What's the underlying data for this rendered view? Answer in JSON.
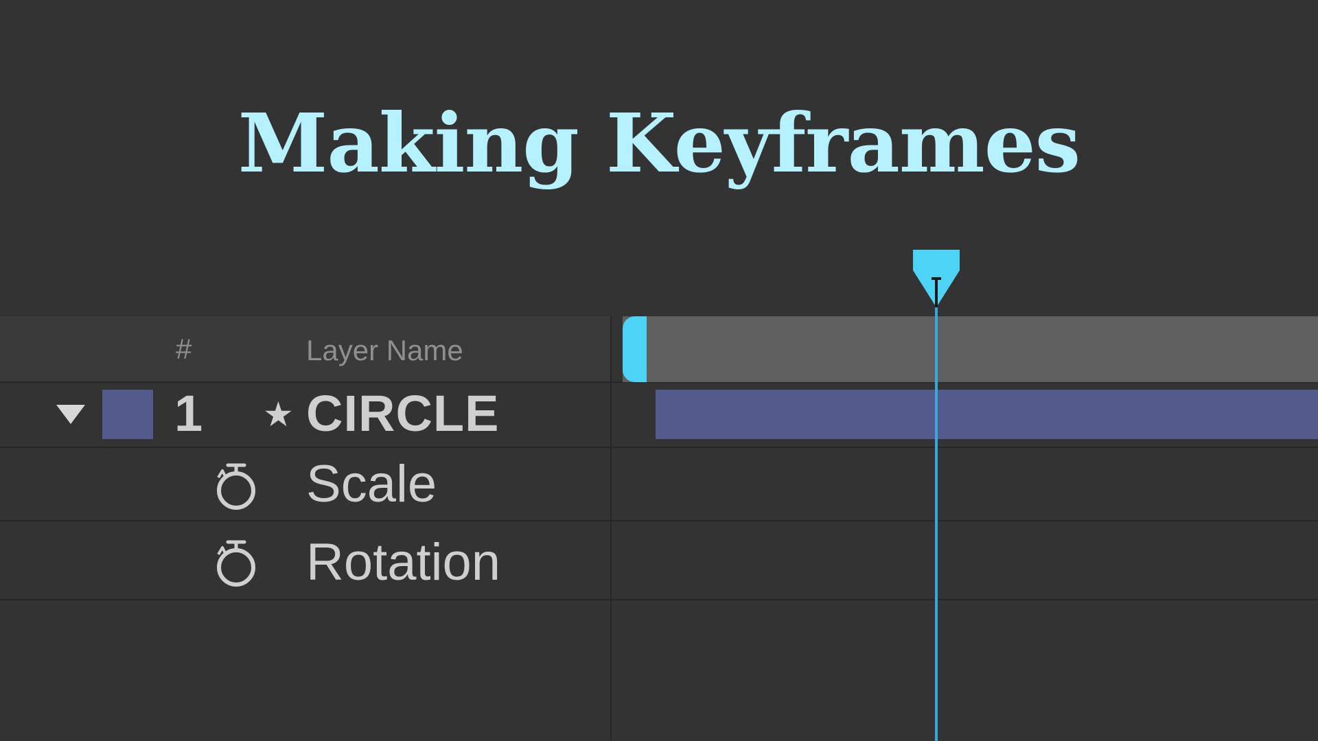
{
  "title": "Making Keyframes",
  "colors": {
    "title": "#b6f1ff",
    "accent": "#4cd3f5",
    "playhead_line": "#3aa6d9",
    "layer_label": "#525b8c",
    "work_area": "#5f5f5f",
    "background": "#333333"
  },
  "timeline": {
    "header": {
      "number_label": "#",
      "name_label": "Layer Name"
    },
    "layers": [
      {
        "number": "1",
        "name": "CIRCLE",
        "expanded": true,
        "icons": [
          "expand-triangle-icon",
          "star-icon"
        ],
        "properties": [
          {
            "name": "Scale",
            "icon": "stopwatch-icon"
          },
          {
            "name": "Rotation",
            "icon": "stopwatch-icon"
          }
        ]
      }
    ],
    "playhead_icon": "playhead-marker-icon"
  }
}
